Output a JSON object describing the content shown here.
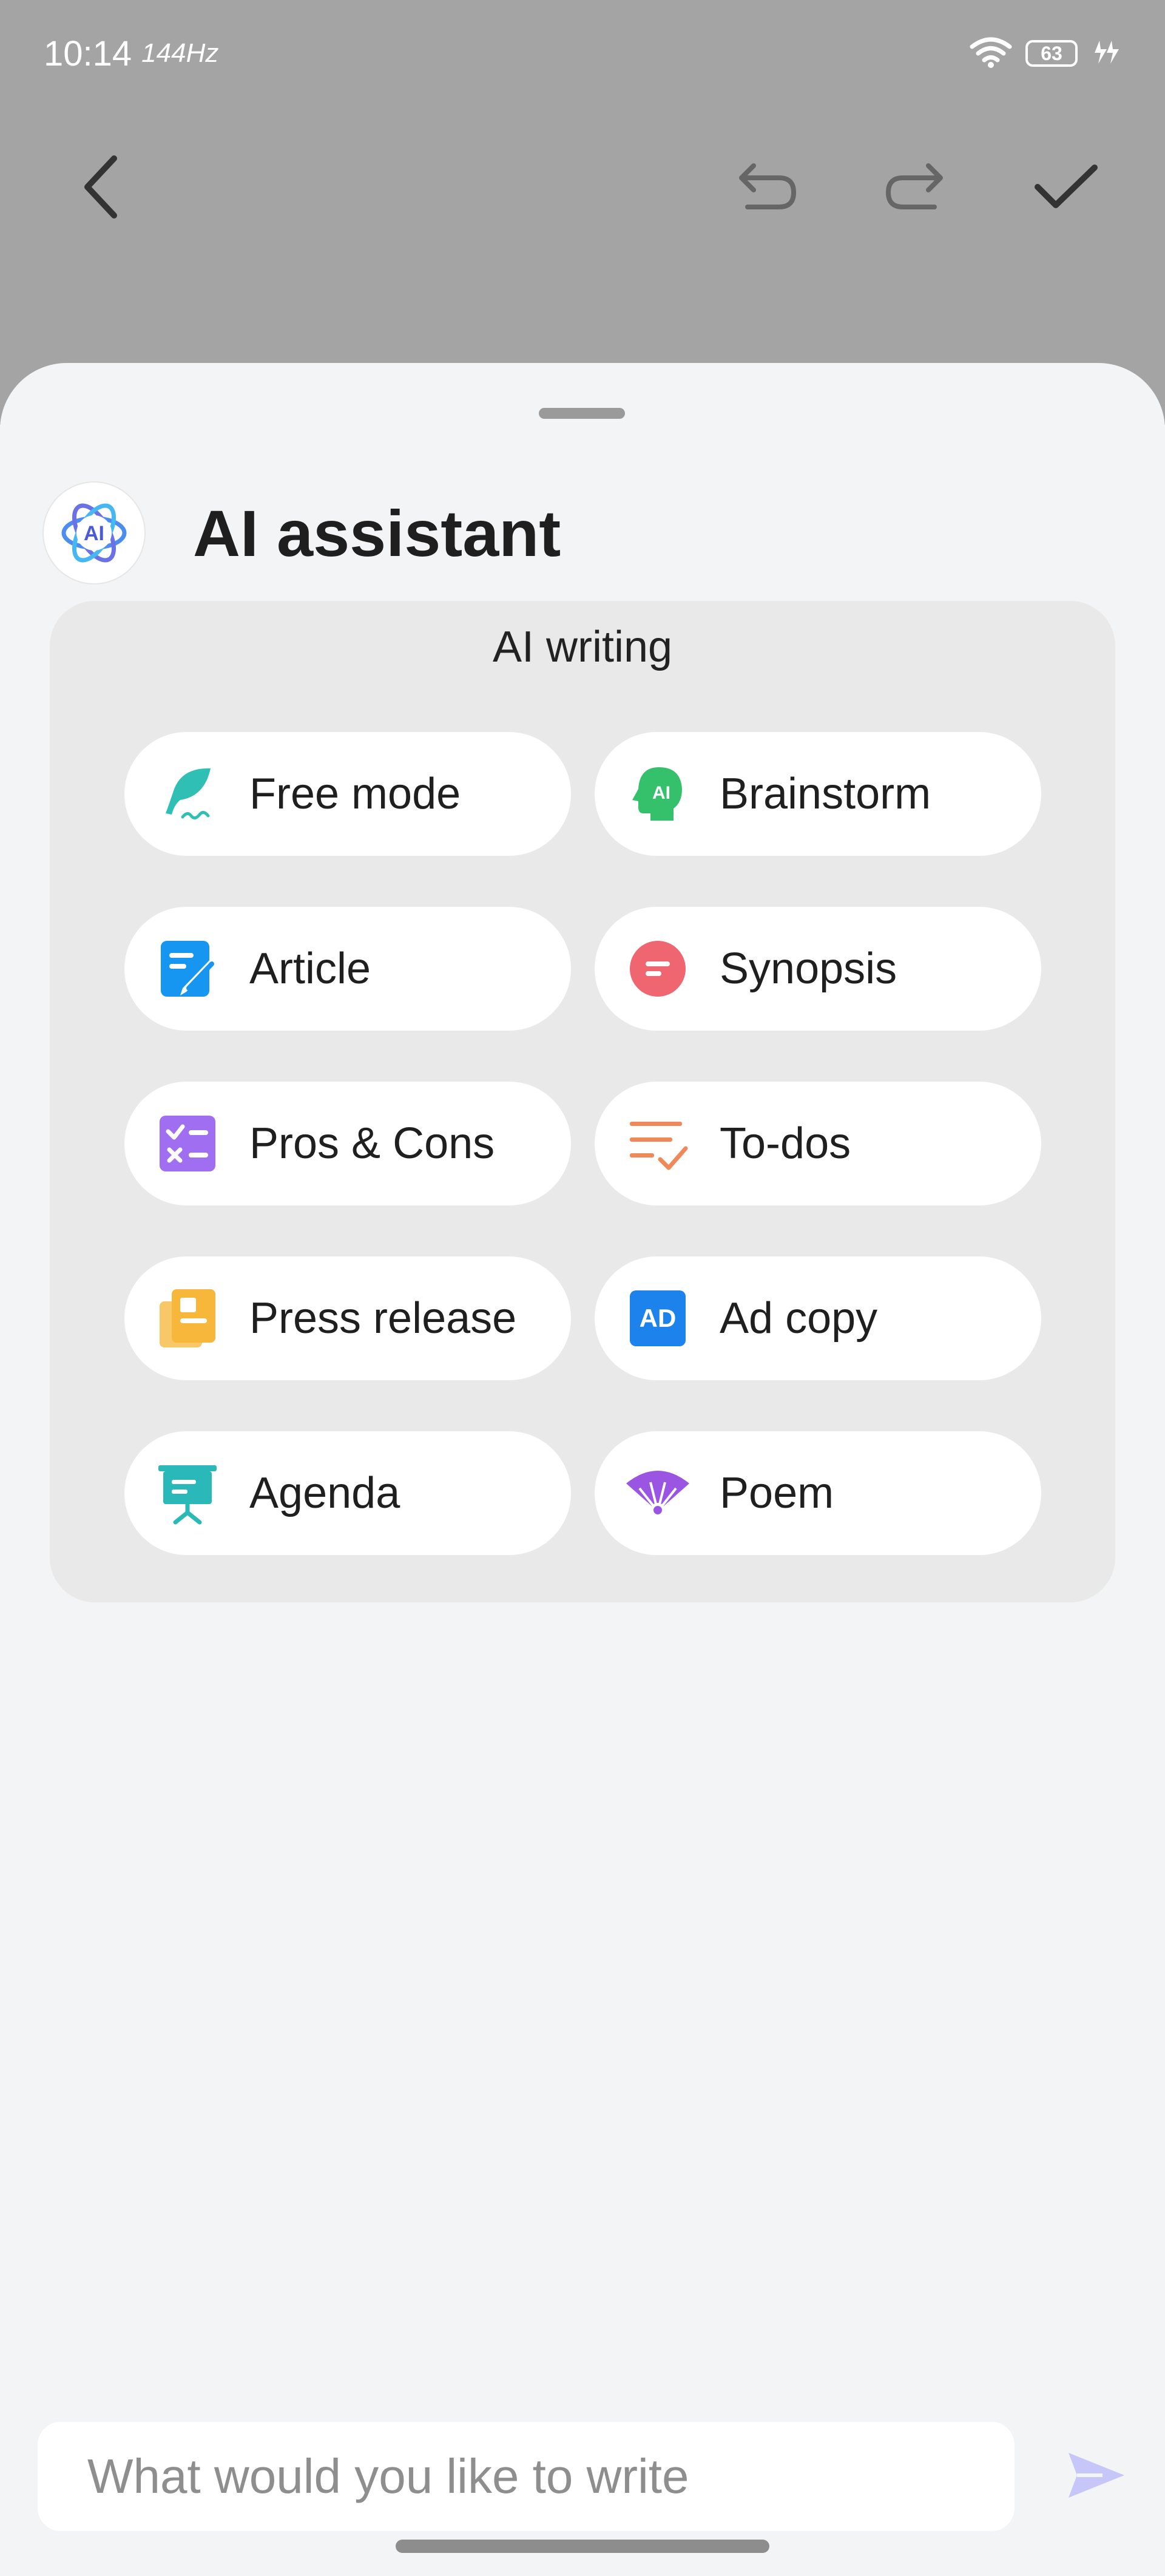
{
  "status_bar": {
    "time": "10:14",
    "refresh_rate": "144Hz",
    "battery": "63"
  },
  "assistant": {
    "title": "AI assistant",
    "logo_text": "AI"
  },
  "ai_writing": {
    "title": "AI writing",
    "options": [
      {
        "label": "Free mode",
        "icon": "feather-icon",
        "color": "#2fbfb5"
      },
      {
        "label": "Brainstorm",
        "icon": "ai-head-icon",
        "color": "#35c06b"
      },
      {
        "label": "Article",
        "icon": "article-edit-icon",
        "color": "#1696f0"
      },
      {
        "label": "Synopsis",
        "icon": "synopsis-icon",
        "color": "#ef6670"
      },
      {
        "label": "Pros & Cons",
        "icon": "checklist-icon",
        "color": "#a06ef0"
      },
      {
        "label": "To-dos",
        "icon": "todo-list-icon",
        "color": "#f0895a"
      },
      {
        "label": "Press release",
        "icon": "press-release-icon",
        "color": "#f7b73a"
      },
      {
        "label": "Ad copy",
        "icon": "ad-icon",
        "color": "#1c83ec"
      },
      {
        "label": "Agenda",
        "icon": "presentation-board-icon",
        "color": "#2ab9b8"
      },
      {
        "label": "Poem",
        "icon": "fan-icon",
        "color": "#9b55e3"
      }
    ]
  },
  "input": {
    "placeholder": "What would you like to write"
  },
  "colors": {
    "top_overlay": "#a4a4a4",
    "sheet": "#f3f4f6",
    "card": "#e9e9e9",
    "send": "#c6c7f8"
  }
}
